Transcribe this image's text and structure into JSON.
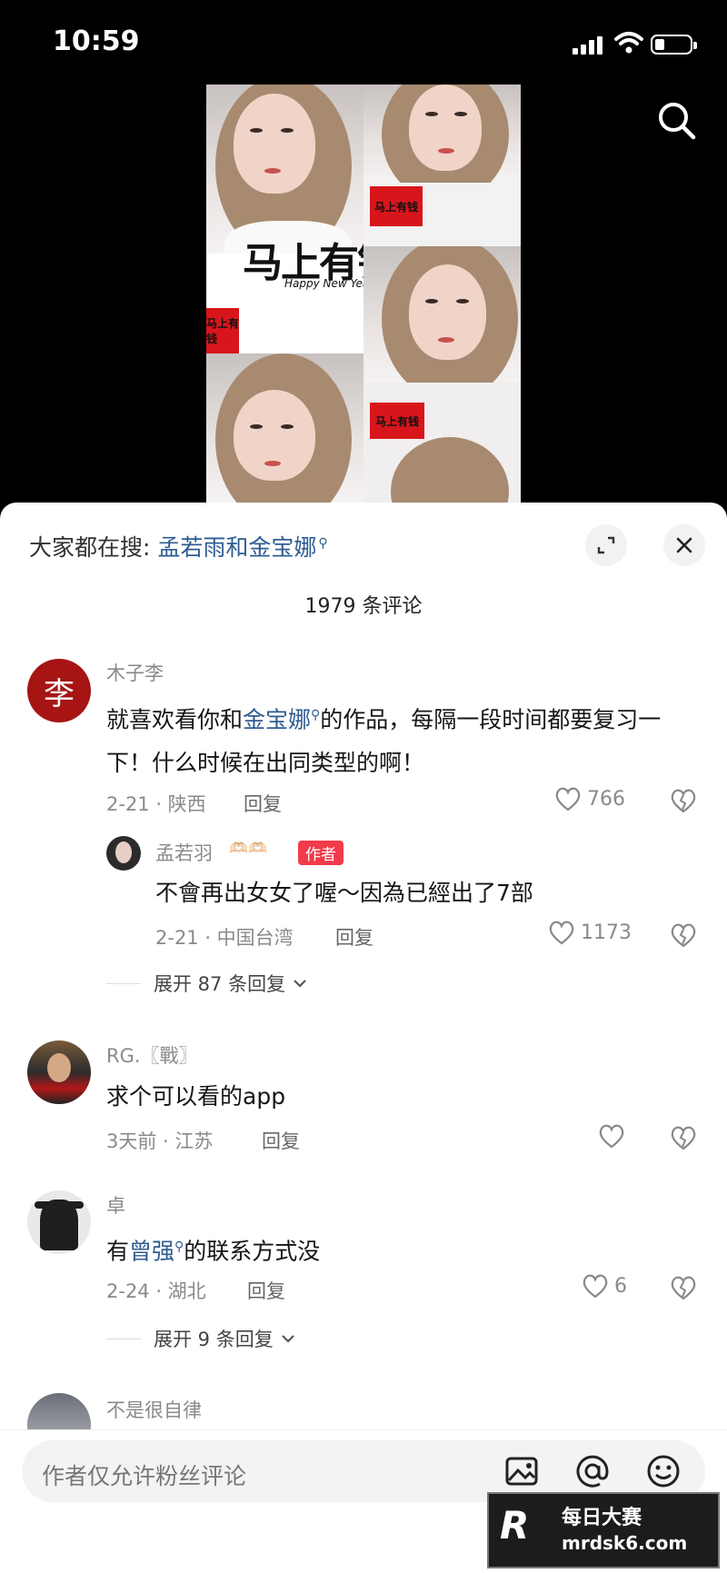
{
  "status": {
    "time": "10:59"
  },
  "video": {
    "calligraphy": "马上有钱",
    "calligraphy_sub": "Happy New Year",
    "red_card": "马上有钱"
  },
  "sheet": {
    "hot_search_prefix": "大家都在搜:",
    "hot_search_term": "孟若雨和金宝娜",
    "comment_count": "1979 条评论"
  },
  "comments": [
    {
      "username": "木子李",
      "avatar_char": "李",
      "text_before": "就喜欢看你和",
      "text_link": "金宝娜",
      "text_after": "的作品，每隔一段时间都要复习一下！什么时候在出同类型的啊！",
      "date_location": "2-21 · 陕西",
      "reply_label": "回复",
      "likes": "766"
    },
    {
      "username": "孟若羽",
      "emoji": "🫶🏻🫶🏻",
      "author_badge": "作者",
      "text": "不會再出女女了喔～因為已經出了7部",
      "date_location": "2-21 · 中国台湾",
      "reply_label": "回复",
      "likes": "1173"
    },
    {
      "username": "RG.〖戰〗",
      "text": "求个可以看的app",
      "date_location": "3天前 · 江苏",
      "reply_label": "回复"
    },
    {
      "username": "卓",
      "text_before": "有",
      "text_link": "曾强",
      "text_after": "的联系方式没",
      "date_location": "2-24 · 湖北",
      "reply_label": "回复",
      "likes": "6"
    },
    {
      "username": "不是很自律"
    }
  ],
  "expand": [
    {
      "label": "展开 87 条回复"
    },
    {
      "label": "展开 9 条回复"
    }
  ],
  "input": {
    "placeholder": "作者仅允许粉丝评论"
  },
  "watermark": {
    "logo": "R",
    "line1": "每日大赛",
    "line2": "mrdsk6.com"
  },
  "colors": {
    "link": "#2f5c91",
    "author_badge": "#f23b4a"
  }
}
